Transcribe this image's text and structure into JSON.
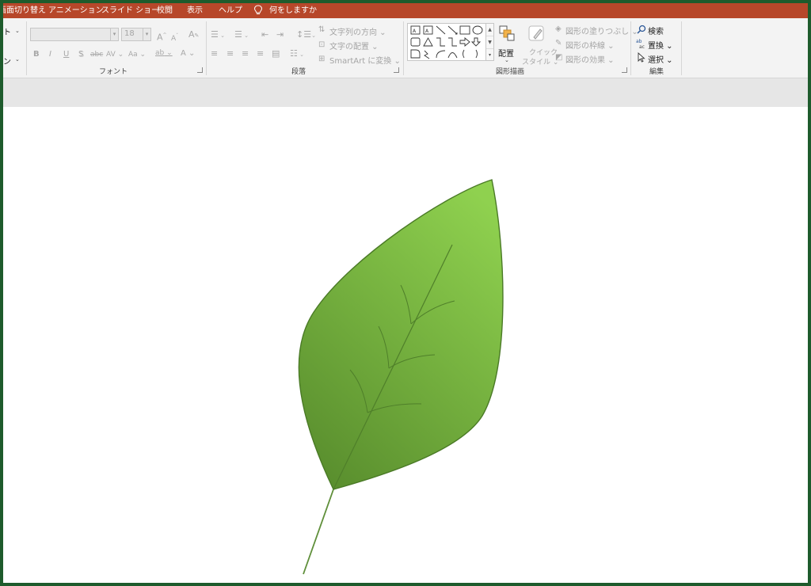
{
  "menubar": {
    "tabs": [
      "画面切り替え",
      "アニメーション",
      "スライド ショー",
      "校閲",
      "表示",
      "ヘルプ"
    ],
    "tell_me": "何をしますか"
  },
  "ribbon": {
    "clipboard_partial": [
      "ト",
      "ン"
    ],
    "font": {
      "label": "フォント",
      "font_name_value": "",
      "font_size_value": "18",
      "grow_icon": "A",
      "shrink_icon": "A",
      "clear_icon": "A",
      "bold": "B",
      "italic": "I",
      "underline": "U",
      "shadow": "S",
      "strike": "abc",
      "spacing": "AV",
      "case": "Aa",
      "highlight": "ab",
      "font_color": "A"
    },
    "paragraph": {
      "label": "段落",
      "text_direction": "文字列の方向",
      "align_text": "文字の配置",
      "smartart": "SmartArt に変換"
    },
    "drawing": {
      "label": "図形描画",
      "arrange": "配置",
      "quick_styles_1": "クイック",
      "quick_styles_2": "スタイル",
      "shape_fill": "図形の塗りつぶし",
      "shape_outline": "図形の枠線",
      "shape_effects": "図形の効果"
    },
    "editing": {
      "label": "編集",
      "find": "検索",
      "replace": "置換",
      "select": "選択"
    }
  },
  "icons": {
    "tell_me": "lightbulb-icon",
    "find": "magnifier-icon",
    "replace": "abc-replace-icon",
    "select": "cursor-arrow-icon",
    "arrange": "arrange-shapes-icon",
    "quick_styles": "paint-brush-icon"
  },
  "colors": {
    "accent": "#b7472a",
    "window_border": "#1e5b2c",
    "leaf_light": "#8fd14f",
    "leaf_dark": "#5a8f2e",
    "leaf_outline": "#4a7a26"
  }
}
